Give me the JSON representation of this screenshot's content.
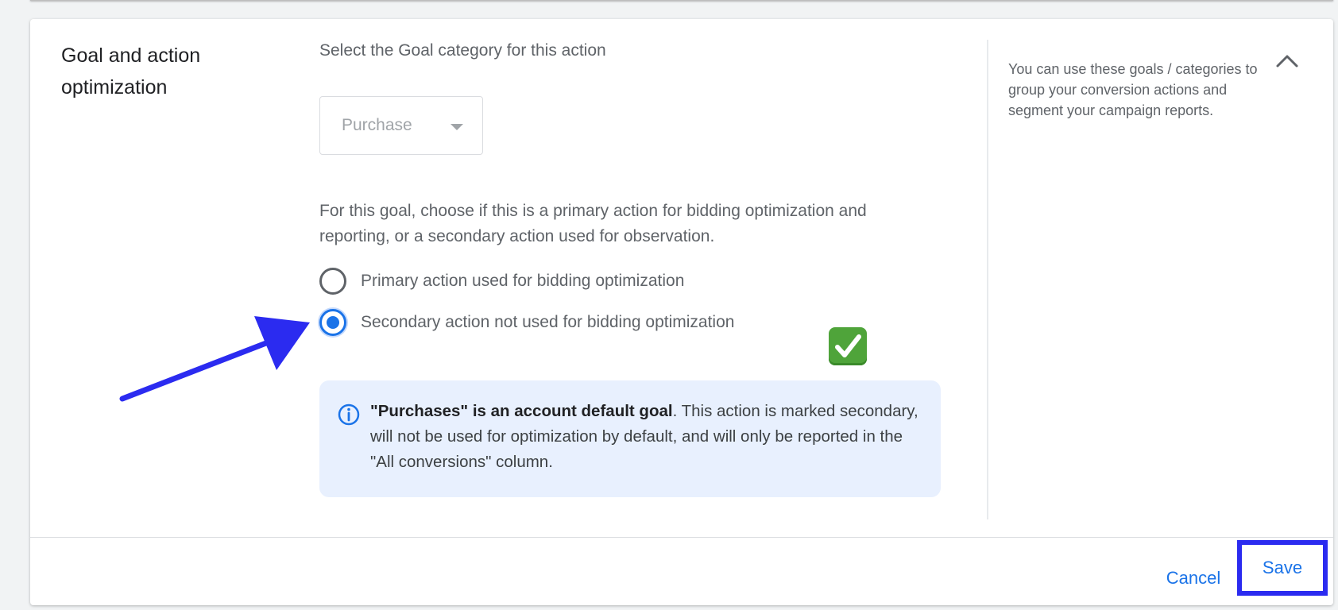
{
  "section": {
    "title": "Goal and action optimization"
  },
  "goal": {
    "label": "Select the Goal category for this action",
    "dropdown_value": "Purchase"
  },
  "optimization": {
    "description": "For this goal, choose if this is a primary action for bidding optimization and reporting, or a secondary action used for observation.",
    "options": [
      {
        "label": "Primary action used for bidding optimization",
        "selected": false
      },
      {
        "label": "Secondary action not used for bidding optimization",
        "selected": true
      }
    ],
    "selected_marker": "check-mark-button-emoji"
  },
  "info": {
    "bold": "\"Purchases\" is an account default goal",
    "text": ". This action is marked secondary, will not be used for optimization by default, and will only be reported in the \"All conversions\" column.",
    "icon": "info-icon"
  },
  "help": {
    "text": "You can use these goals / categories to group your conversion actions and segment your campaign reports."
  },
  "footer": {
    "cancel_label": "Cancel",
    "save_label": "Save"
  },
  "colors": {
    "accent": "#1a73e8",
    "info_bg": "#e8f0fe",
    "annotation": "#2b2bf0",
    "check_green": "#4fa43a"
  }
}
